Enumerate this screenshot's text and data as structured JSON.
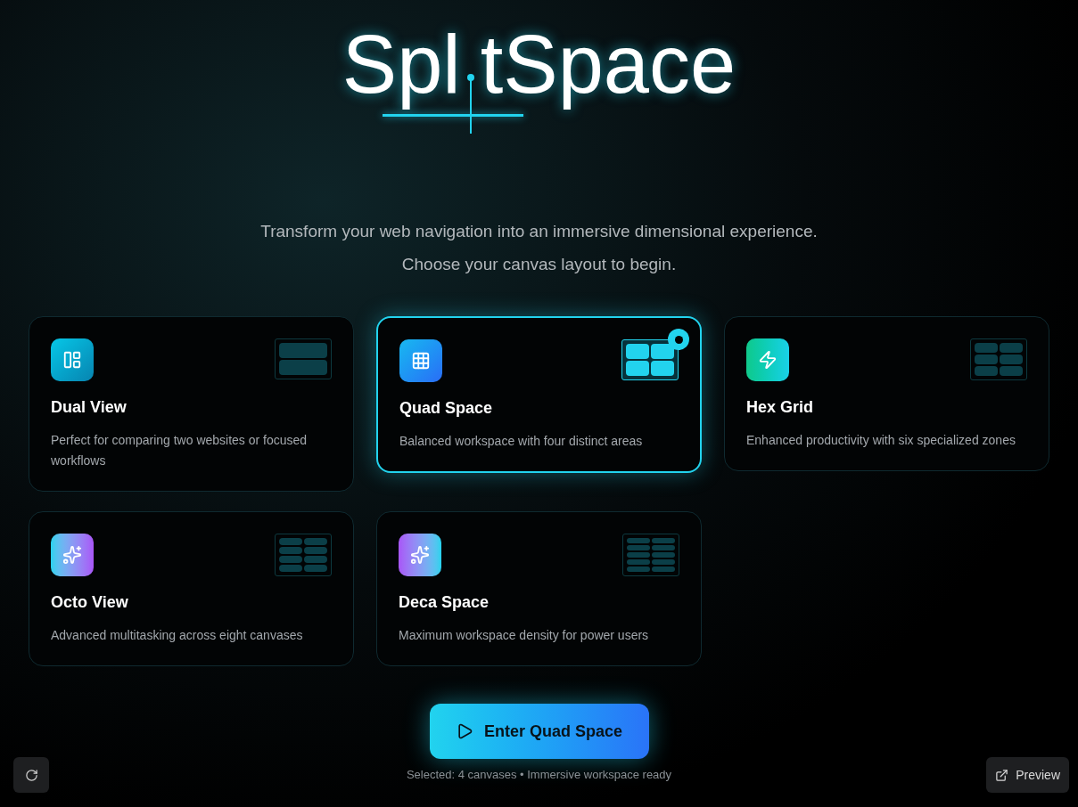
{
  "logo": {
    "before": "Spl",
    "after": "tSpace"
  },
  "tagline": [
    "Transform your web navigation into an immersive dimensional experience.",
    "Choose your canvas layout to begin."
  ],
  "layouts": [
    {
      "title": "Dual View",
      "description": "Perfect for comparing two websites or focused workflows",
      "selected": false
    },
    {
      "title": "Quad Space",
      "description": "Balanced workspace with four distinct areas",
      "selected": true
    },
    {
      "title": "Hex Grid",
      "description": "Enhanced productivity with six specialized zones",
      "selected": false
    },
    {
      "title": "Octo View",
      "description": "Advanced multitasking across eight canvases",
      "selected": false
    },
    {
      "title": "Deca Space",
      "description": "Maximum workspace density for power users",
      "selected": false
    }
  ],
  "enter_button": "Enter Quad Space",
  "status": "Selected: 4 canvases • Immersive workspace ready",
  "preview_button": "Preview"
}
